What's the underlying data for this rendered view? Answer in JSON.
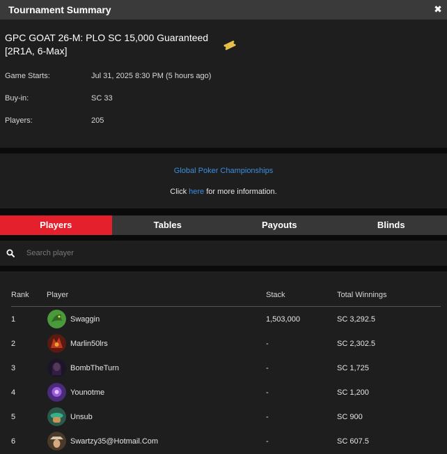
{
  "window": {
    "title": "Tournament Summary"
  },
  "tournament": {
    "name_line1": "GPC GOAT 26-M: PLO SC 15,000 Guaranteed",
    "name_line2": "[2R1A, 6-Max]",
    "game_starts_label": "Game Starts:",
    "game_starts_value": "Jul 31, 2025 8:30 PM (5 hours ago)",
    "buyin_label": "Buy-in:",
    "buyin_value": "SC 33",
    "players_label": "Players:",
    "players_value": "205"
  },
  "promo": {
    "title": "Global Poker Championships",
    "click_text": "Click ",
    "link_text": "here",
    "after_text": " for more information."
  },
  "tabs": [
    {
      "label": "Players",
      "active": true
    },
    {
      "label": "Tables",
      "active": false
    },
    {
      "label": "Payouts",
      "active": false
    },
    {
      "label": "Blinds",
      "active": false
    }
  ],
  "search": {
    "placeholder": "Search player"
  },
  "table": {
    "headers": {
      "rank": "Rank",
      "player": "Player",
      "stack": "Stack",
      "winnings": "Total Winnings"
    },
    "rows": [
      {
        "rank": "1",
        "player": "Swaggin",
        "stack": "1,503,000",
        "winnings": "SC 3,292.5",
        "avatar_color": "#4a9a3c"
      },
      {
        "rank": "2",
        "player": "Marlin50lrs",
        "stack": "-",
        "winnings": "SC 2,302.5",
        "avatar_color": "#b3301e"
      },
      {
        "rank": "3",
        "player": "BombTheTurn",
        "stack": "-",
        "winnings": "SC 1,725",
        "avatar_color": "#2a1f3a"
      },
      {
        "rank": "4",
        "player": "Younotme",
        "stack": "-",
        "winnings": "SC 1,200",
        "avatar_color": "#7a3fb8"
      },
      {
        "rank": "5",
        "player": "Unsub",
        "stack": "-",
        "winnings": "SC 900",
        "avatar_color": "#3a8f6a"
      },
      {
        "rank": "6",
        "player": "Swartzy35@Hotmail.Com",
        "stack": "-",
        "winnings": "SC 607.5",
        "avatar_color": "#8a6a4a"
      }
    ]
  },
  "colors": {
    "accent": "#e3202c",
    "link": "#3f8ede",
    "panel": "#1e1e1e",
    "background": "#0b0b0b"
  }
}
